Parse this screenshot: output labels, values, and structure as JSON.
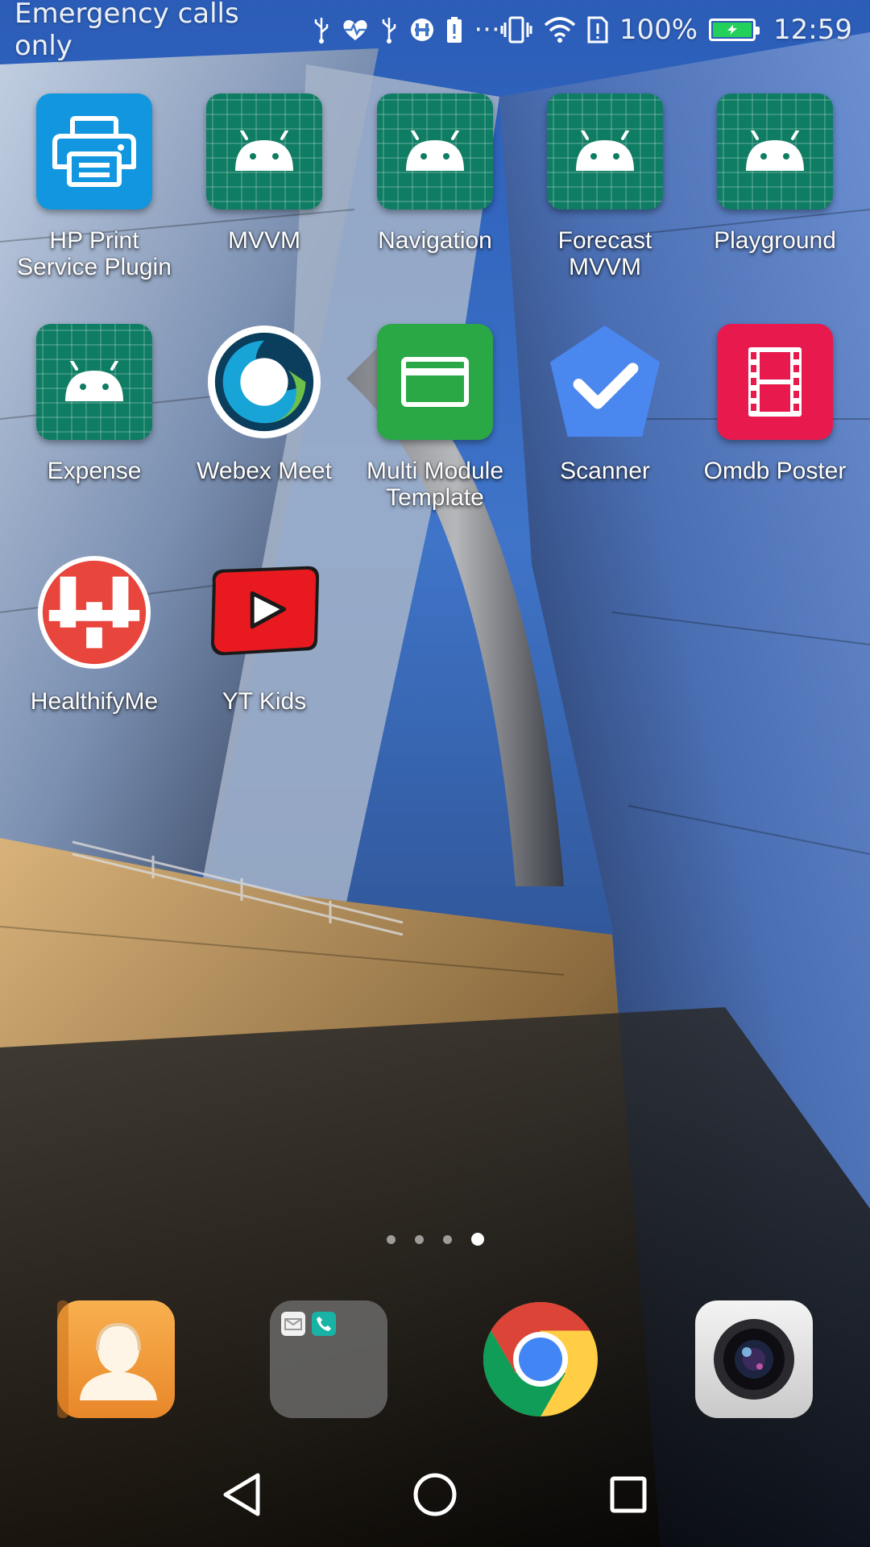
{
  "status_bar": {
    "carrier_text": "Emergency calls only",
    "battery_percent": "100%",
    "time": "12:59",
    "left_icons": [
      "usb-icon",
      "heart-rate-icon",
      "usb-icon",
      "healthifyme-notification-icon",
      "battery-alert-icon",
      "more-dots-icon"
    ],
    "right_icons": [
      "vibrate-icon",
      "wifi-icon",
      "sim-alert-icon",
      "battery-icon"
    ],
    "more_glyph": "···"
  },
  "apps": [
    {
      "label_line1": "HP Print",
      "label_line2": "Service Plugin",
      "icon": "hp-printer-icon"
    },
    {
      "label_line1": "MVVM",
      "label_line2": "",
      "icon": "android-icon"
    },
    {
      "label_line1": "Navigation",
      "label_line2": "",
      "icon": "android-icon"
    },
    {
      "label_line1": "Forecast",
      "label_line2": "MVVM",
      "icon": "android-icon"
    },
    {
      "label_line1": "Playground",
      "label_line2": "",
      "icon": "android-icon"
    },
    {
      "label_line1": "Expense",
      "label_line2": "",
      "icon": "android-icon"
    },
    {
      "label_line1": "Webex Meet",
      "label_line2": "",
      "icon": "webex-icon"
    },
    {
      "label_line1": "Multi Module",
      "label_line2": "Template",
      "icon": "card-icon"
    },
    {
      "label_line1": "Scanner",
      "label_line2": "",
      "icon": "check-pentagon-icon"
    },
    {
      "label_line1": "Omdb Poster",
      "label_line2": "",
      "icon": "film-icon"
    },
    {
      "label_line1": "HealthifyMe",
      "label_line2": "",
      "icon": "healthifyme-icon"
    },
    {
      "label_line1": "YT Kids",
      "label_line2": "",
      "icon": "yt-kids-icon"
    }
  ],
  "page_indicator": {
    "total": 4,
    "active_index": 3
  },
  "dock": [
    {
      "name": "contacts",
      "icon": "contacts-icon"
    },
    {
      "name": "messaging-phone-folder",
      "icon": "folder-icon"
    },
    {
      "name": "chrome",
      "icon": "chrome-icon"
    },
    {
      "name": "camera",
      "icon": "camera-icon"
    }
  ],
  "navigation": {
    "buttons": [
      "back-icon",
      "home-icon",
      "recents-icon"
    ]
  },
  "colors": {
    "android_tile": "#0f7d63",
    "hp_blue": "#1196df",
    "multi_module_green": "#2aa846",
    "scanner_blue": "#4a87ee",
    "omdb_red": "#e7194d",
    "healthify_red": "#e8453c",
    "battery_green": "#22d05a"
  }
}
